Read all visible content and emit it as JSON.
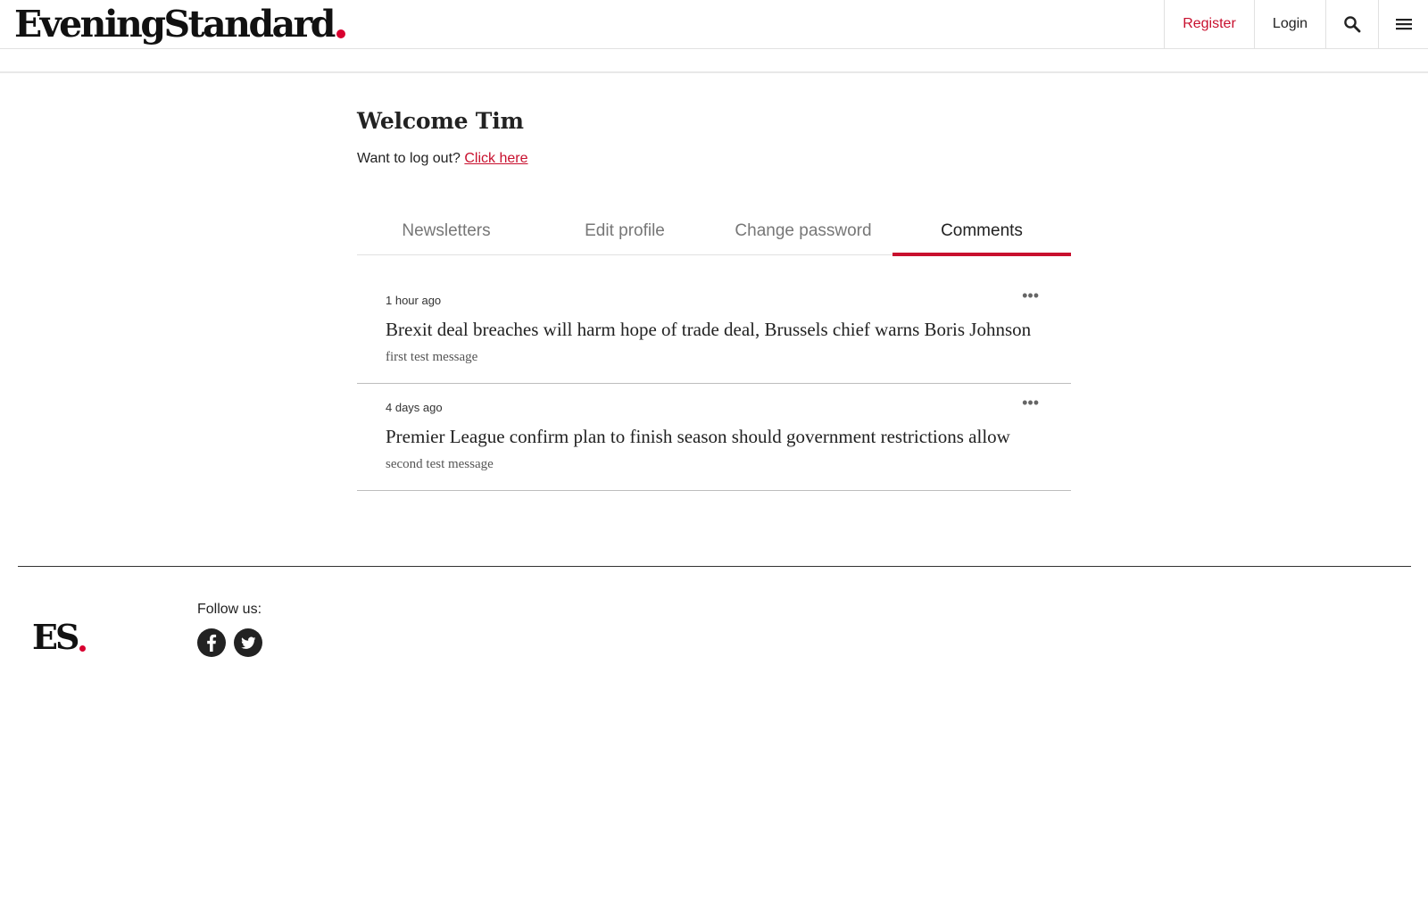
{
  "header": {
    "logo_text": "EveningStandard",
    "nav": {
      "register": "Register",
      "login": "Login",
      "search_icon": "search-icon",
      "menu_icon": "hamburger-menu-icon"
    }
  },
  "account": {
    "welcome": "Welcome Tim",
    "logout_prompt": "Want to log out?",
    "logout_link": "Click here",
    "tabs": [
      {
        "label": "Newsletters",
        "active": false
      },
      {
        "label": "Edit profile",
        "active": false
      },
      {
        "label": "Change password",
        "active": false
      },
      {
        "label": "Comments",
        "active": true
      }
    ]
  },
  "comments": [
    {
      "time": "1 hour ago",
      "article_title": "Brexit deal breaches will harm hope of trade deal, Brussels chief warns Boris Johnson",
      "message": "first test message",
      "menu": "•••"
    },
    {
      "time": "4 days ago",
      "article_title": "Premier League confirm plan to finish season should government restrictions allow",
      "message": "second test message",
      "menu": "•••"
    }
  ],
  "footer": {
    "logo_text": "ES",
    "follow_label": "Follow us:",
    "social": [
      "facebook-icon",
      "twitter-icon"
    ]
  },
  "colors": {
    "accent": "#c8102e",
    "text": "#222222",
    "muted": "#777777"
  }
}
